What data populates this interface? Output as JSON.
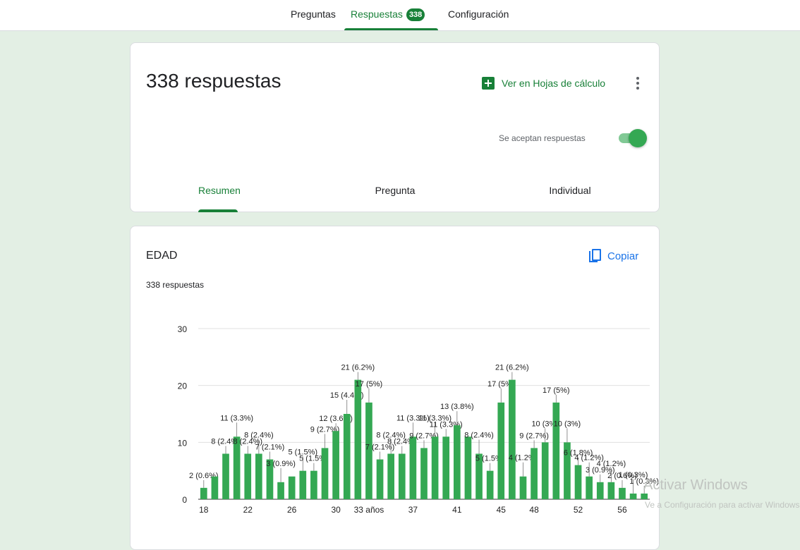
{
  "nav": {
    "tabs": [
      {
        "label": "Preguntas"
      },
      {
        "label": "Respuestas",
        "badge": "338"
      },
      {
        "label": "Configuración"
      }
    ]
  },
  "summary": {
    "title": "338 respuestas",
    "sheets_label": "Ver en Hojas de cálculo",
    "accepting_label": "Se aceptan respuestas",
    "accepting": true,
    "subtabs": [
      "Resumen",
      "Pregunta",
      "Individual"
    ]
  },
  "question": {
    "title": "EDAD",
    "count": "338 respuestas",
    "copy_label": "Copiar"
  },
  "watermark": {
    "title": "Activar Windows",
    "subtitle": "Ve a Configuración para activar Windows."
  },
  "colors": {
    "accent": "#188038",
    "bar": "#34a853",
    "link": "#1a73e8",
    "background": "#e3efe4"
  },
  "icons": [
    "sheets-icon",
    "more-vert-icon",
    "copy-icon"
  ],
  "chart_data": {
    "type": "bar",
    "categories": [
      "18",
      "19",
      "20",
      "21",
      "22",
      "23",
      "24",
      "25",
      "26",
      "27",
      "28",
      "29",
      "30",
      "31",
      "32",
      "33 años",
      "34",
      "35",
      "36",
      "37",
      "38",
      "39",
      "40",
      "41",
      "42",
      "43",
      "44",
      "45",
      "46",
      "47",
      "48",
      "49",
      "50",
      "51",
      "52",
      "53",
      "54",
      "55",
      "56",
      "57",
      "58"
    ],
    "values": [
      2,
      4,
      8,
      11,
      8,
      8,
      7,
      3,
      4,
      5,
      5,
      9,
      12,
      15,
      21,
      17,
      7,
      8,
      8,
      11,
      9,
      11,
      11,
      13,
      11,
      8,
      5,
      17,
      21,
      4,
      9,
      10,
      17,
      10,
      6,
      4,
      3,
      3,
      2,
      1,
      1
    ],
    "labels": [
      "2 (0.6%)",
      "",
      "8 (2.4%)",
      "11 (3.3%)",
      "8 (2.4%)",
      "8 (2.4%)",
      "7 (2.1%)",
      "3 (0.9%)",
      "",
      "5 (1.5%)",
      "5 (1.5%)",
      "9 (2.7%)",
      "12 (3.6%)",
      "15 (4.4%)",
      "21 (6.2%)",
      "17 (5%)",
      "7 (2.1%)",
      "8 (2.4%)",
      "8 (2.4%)",
      "11 (3.3%)",
      "9 (2.7%)",
      "11 (3.3%)",
      "11 (3.3%)",
      "13 (3.8%)",
      "",
      "8 (2.4%)",
      "5 (1.5%)",
      "17 (5%)",
      "21 (6.2%)",
      "4 (1.2%)",
      "9 (2.7%)",
      "10 (3%)",
      "17 (5%)",
      "10 (3%)",
      "6 (1.8%)",
      "4 (1.2%)",
      "3 (0.9%)",
      "4 (1.2%)",
      "2 (0.6%)",
      "1 (0.3%)",
      "1 (0.3%)"
    ],
    "xticks": [
      "18",
      "22",
      "26",
      "30",
      "33 años",
      "37",
      "41",
      "45",
      "48",
      "52",
      "56"
    ],
    "yticks": [
      0,
      10,
      20,
      30
    ],
    "ylim": [
      0,
      30
    ],
    "grid": true
  }
}
